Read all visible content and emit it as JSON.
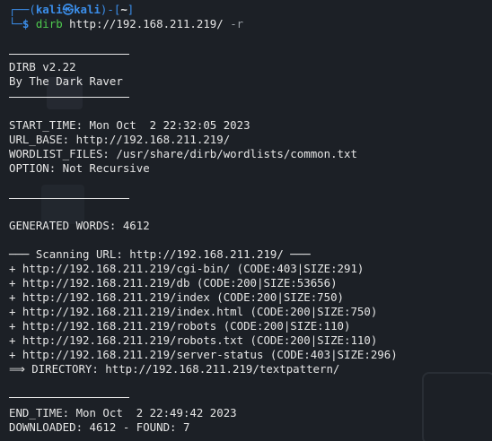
{
  "prompt": {
    "frame_top_left": "┌──(",
    "user_host": "kali㉿kali",
    "frame_mid": ")-[",
    "dir": "~",
    "frame_close": "]",
    "frame_bottom": "└─",
    "dollar": "$ ",
    "command": "dirb",
    "args": " http://192.168.211.219/ ",
    "flag": "-r"
  },
  "banner": {
    "title": "DIRB v2.22",
    "author": "By The Dark Raver"
  },
  "info": {
    "start_time": "START_TIME: Mon Oct  2 22:32:05 2023",
    "url_base": "URL_BASE: http://192.168.211.219/",
    "wordlist": "WORDLIST_FILES: /usr/share/dirb/wordlists/common.txt",
    "option": "OPTION: Not Recursive"
  },
  "generated": "GENERATED WORDS: 4612",
  "scanning": "─── Scanning URL: http://192.168.211.219/ ───",
  "results": [
    "+ http://192.168.211.219/cgi-bin/ (CODE:403|SIZE:291)",
    "+ http://192.168.211.219/db (CODE:200|SIZE:53656)",
    "+ http://192.168.211.219/index (CODE:200|SIZE:750)",
    "+ http://192.168.211.219/index.html (CODE:200|SIZE:750)",
    "+ http://192.168.211.219/robots (CODE:200|SIZE:110)",
    "+ http://192.168.211.219/robots.txt (CODE:200|SIZE:110)",
    "+ http://192.168.211.219/server-status (CODE:403|SIZE:296)",
    "⟹ DIRECTORY: http://192.168.211.219/textpattern/"
  ],
  "footer": {
    "end_time": "END_TIME: Mon Oct  2 22:49:42 2023",
    "downloaded": "DOWNLOADED: 4612 - FOUND: 7"
  }
}
